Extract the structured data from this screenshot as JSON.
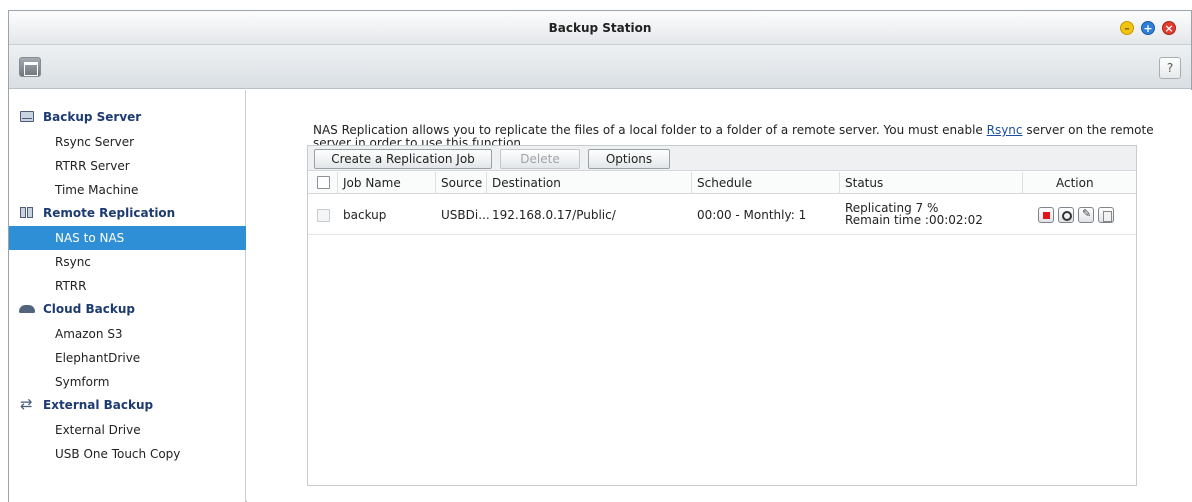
{
  "window": {
    "title": "Backup Station"
  },
  "toolbar": {
    "help_label": "?"
  },
  "sidebar": {
    "backup_server": {
      "label": "Backup Server",
      "items": [
        "Rsync Server",
        "RTRR Server",
        "Time Machine"
      ]
    },
    "remote_replication": {
      "label": "Remote Replication",
      "items": [
        "NAS to NAS",
        "Rsync",
        "RTRR"
      ],
      "active": "NAS to NAS"
    },
    "cloud_backup": {
      "label": "Cloud Backup",
      "items": [
        "Amazon S3",
        "ElephantDrive",
        "Symform"
      ]
    },
    "external_backup": {
      "label": "External Backup",
      "items": [
        "External Drive",
        "USB One Touch Copy"
      ]
    }
  },
  "main": {
    "description_part1": "NAS Replication allows you to replicate the files of a local folder to a folder of a remote server. You must enable ",
    "description_link": "Rsync",
    "description_part2": " server on the remote server in order to use this function.",
    "buttons": {
      "create": "Create a Replication Job",
      "delete": "Delete",
      "options": "Options"
    },
    "columns": {
      "job_name": "Job Name",
      "source": "Source",
      "destination": "Destination",
      "schedule": "Schedule",
      "status": "Status",
      "action": "Action"
    },
    "rows": [
      {
        "job_name": "backup",
        "source": "USBDi...",
        "destination": "192.168.0.17/Public/",
        "schedule": "00:00 - Monthly: 1",
        "status_line1": "Replicating 7 %",
        "status_line2": "Remain time :00:02:02"
      }
    ]
  },
  "colors": {
    "accent": "#2f8fd6",
    "section_heading": "#1d3b73",
    "stop_red": "#e2141b"
  },
  "icons": [
    "minimize-icon",
    "maximize-icon",
    "close-icon",
    "panel-toggle-icon",
    "help-icon",
    "server-icon",
    "replication-icon",
    "cloud-icon",
    "sync-icon",
    "stop-icon",
    "view-icon",
    "edit-icon",
    "log-icon"
  ]
}
